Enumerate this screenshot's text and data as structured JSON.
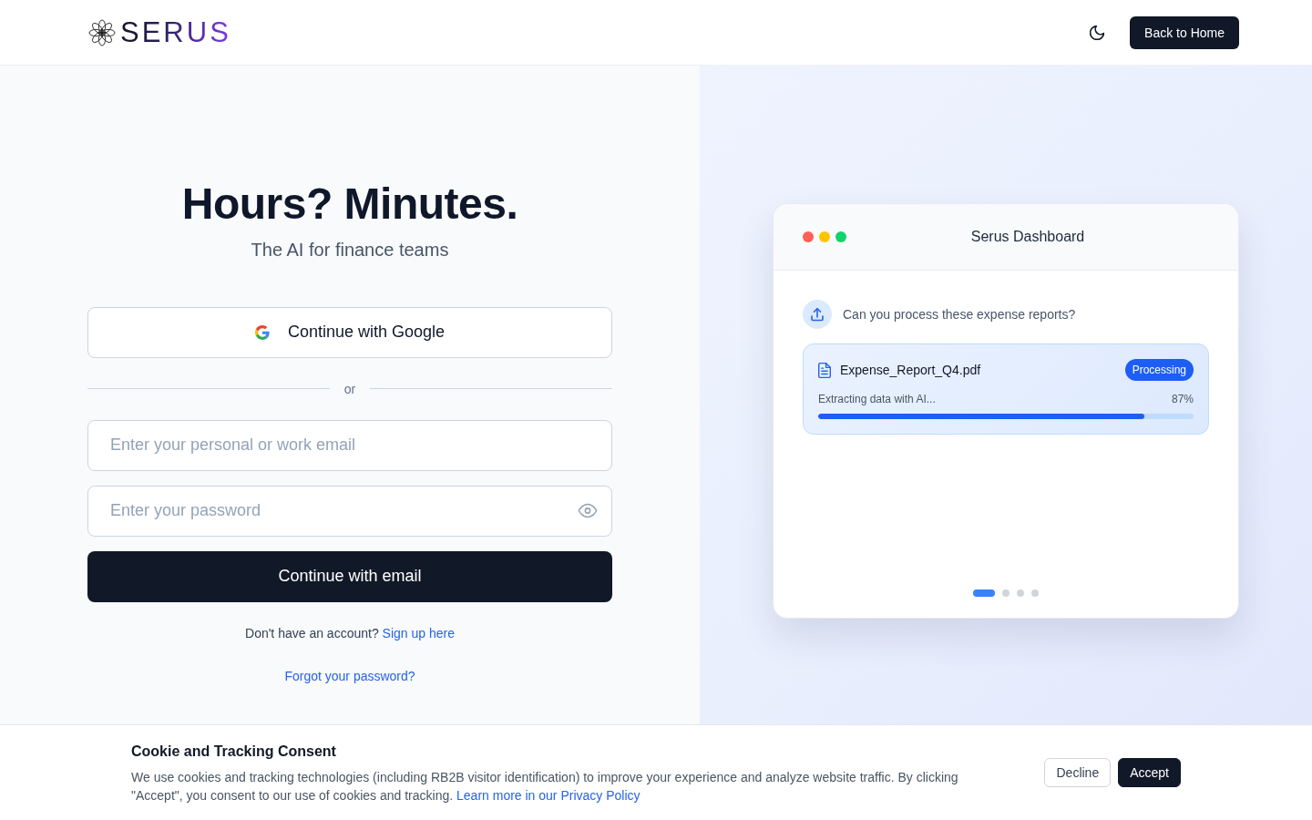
{
  "header": {
    "logo_text": "SERUS",
    "back_button": "Back to Home"
  },
  "hero": {
    "title": "Hours? Minutes.",
    "subtitle": "The AI for finance teams"
  },
  "login": {
    "google_button": "Continue with Google",
    "divider": "or",
    "email": {
      "placeholder": "Enter your personal or work email"
    },
    "password": {
      "placeholder": "Enter your password"
    },
    "submit_button": "Continue with email",
    "signup_prompt": "Don't have an account?",
    "signup_link": "Sign up here",
    "forgot_link": "Forgot your password?"
  },
  "dashboard": {
    "window_controls": [
      {
        "color": "#ff5f57"
      },
      {
        "color": "#ffc400"
      },
      {
        "color": "#12d36b"
      }
    ],
    "title": "Serus Dashboard",
    "message": "Can you process these expense reports?",
    "file": {
      "name": "Expense_Report_Q4.pdf",
      "status": "Processing",
      "step": "Extracting data with AI...",
      "percent": "87%",
      "level": 0.87
    },
    "carousel": [
      {
        "selected": true
      },
      {
        "selected": false
      },
      {
        "selected": false
      },
      {
        "selected": false
      }
    ]
  },
  "cookie_banner": {
    "title": "Cookie and Tracking Consent",
    "text": "We use cookies and tracking technologies (including RB2B visitor identification) to improve your experience and analyze website traffic. By clicking \"Accept\", you consent to our use of cookies and tracking.",
    "link": "Learn more in our Privacy Policy",
    "buttons": [
      {
        "label": "Decline",
        "kind": "secondary"
      },
      {
        "label": "Accept",
        "kind": "primary"
      }
    ]
  }
}
